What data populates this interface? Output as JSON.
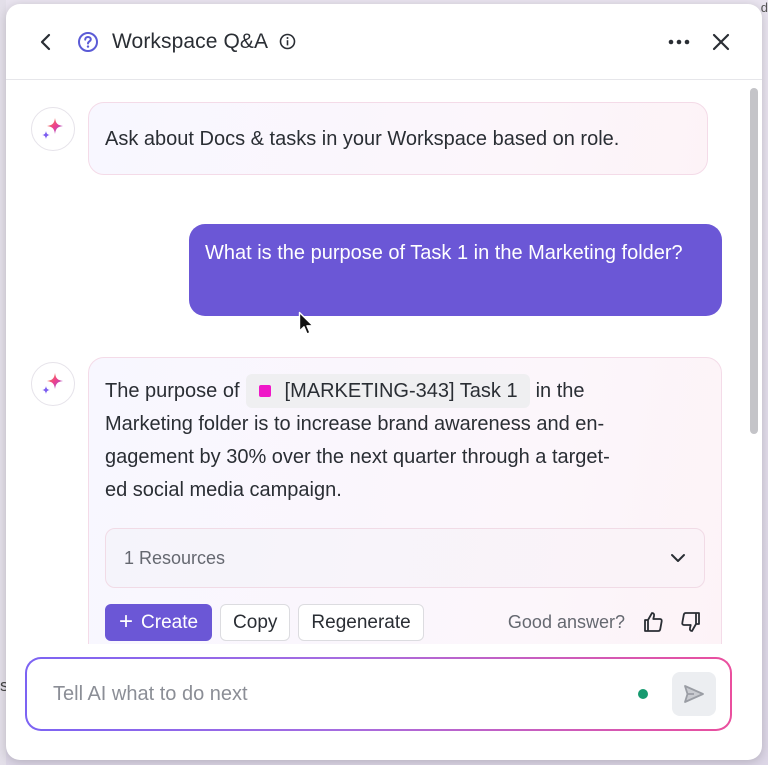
{
  "background": {
    "left_text": "s",
    "right_text": "d"
  },
  "header": {
    "title": "Workspace Q&A",
    "help_icon": "question-circle-icon",
    "info_icon": "info-circle-icon",
    "accent_color": "#5b5bd6"
  },
  "messages": {
    "ai_intro": "Ask about Docs & tasks in your Workspace based on role.",
    "user_question": "What is the purpose of Task 1 in the Marketing folder?",
    "ai_answer": {
      "prefix": "The purpose of",
      "task_chip": "[MARKETING-343] Task 1",
      "suffix_line1": "in the",
      "line2": "Marketing folder is to increase brand awareness and en-",
      "line3": "gagement by 30% over the next quarter through a target-",
      "line4": "ed social media campaign."
    }
  },
  "resources": {
    "label": "1 Resources"
  },
  "actions": {
    "create_label": "Create",
    "copy_label": "Copy",
    "regenerate_label": "Regenerate",
    "feedback_label": "Good answer?"
  },
  "input": {
    "placeholder": "Tell AI what to do next",
    "value": ""
  },
  "colors": {
    "primary": "#6b57d6",
    "status_green": "#169a6f",
    "task_pink": "#ef18c8"
  }
}
